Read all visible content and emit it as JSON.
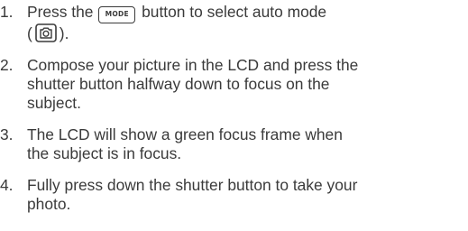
{
  "steps": [
    {
      "number": "1.",
      "text_before_key": "Press the ",
      "key_label": "MODE",
      "text_after_key": " button to select auto mode",
      "paren_open": "(",
      "icon": "auto-mode-camera-icon",
      "paren_close": ")."
    },
    {
      "number": "2.",
      "line1": "Compose your picture in the LCD and press the",
      "line2": "shutter button halfway down to focus on the",
      "line3": "subject."
    },
    {
      "number": "3.",
      "line1": "The LCD will show a green focus frame when",
      "line2": "the subject is in focus."
    },
    {
      "number": "4.",
      "line1": "Fully press down the shutter button to take your",
      "line2": "photo."
    }
  ]
}
